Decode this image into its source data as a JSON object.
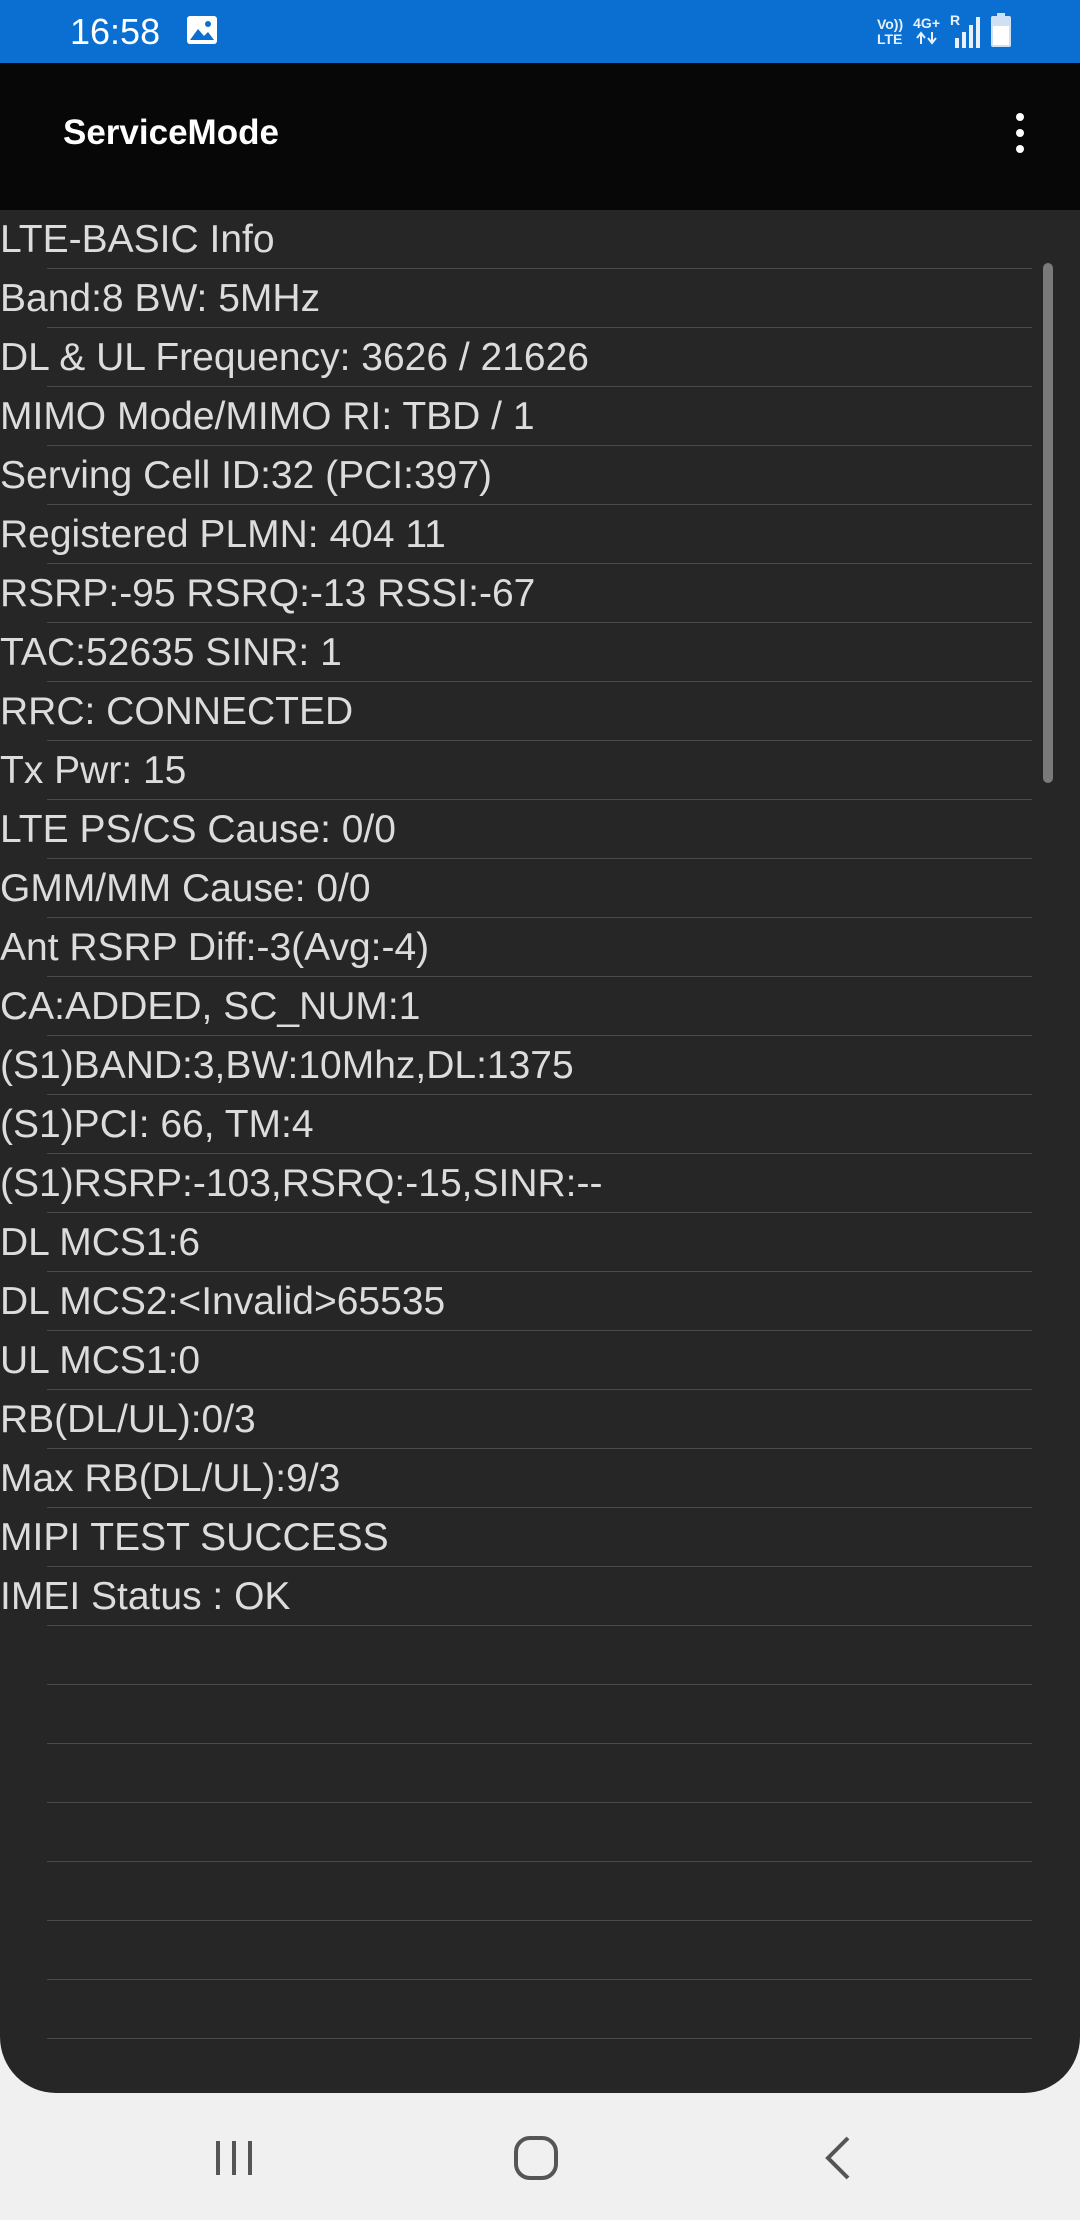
{
  "status_bar": {
    "time": "16:58",
    "volte_top": "Vo))",
    "volte_bottom": "LTE",
    "network": "4G+",
    "roaming": "R",
    "icons": [
      "gallery-icon",
      "volte-icon",
      "data-arrows-icon",
      "signal-icon",
      "battery-icon"
    ]
  },
  "app_bar": {
    "title": "ServiceMode",
    "menu_icon": "more-vert-icon"
  },
  "info_lines": [
    "LTE-BASIC Info",
    "Band:8 BW: 5MHz",
    "DL & UL Frequency: 3626 / 21626",
    "MIMO Mode/MIMO RI: TBD / 1",
    "Serving Cell ID:32 (PCI:397)",
    "Registered PLMN: 404 11",
    "RSRP:-95 RSRQ:-13 RSSI:-67",
    "TAC:52635 SINR: 1",
    "RRC: CONNECTED",
    "Tx Pwr: 15",
    "LTE PS/CS Cause: 0/0",
    "GMM/MM Cause: 0/0",
    "Ant RSRP Diff:-3(Avg:-4)",
    "CA:ADDED, SC_NUM:1",
    "(S1)BAND:3,BW:10Mhz,DL:1375",
    "(S1)PCI: 66, TM:4",
    "(S1)RSRP:-103,RSRQ:-15,SINR:--",
    "DL MCS1:6",
    "DL MCS2:<Invalid>65535",
    "UL MCS1:0",
    "RB(DL/UL):0/3",
    "Max RB(DL/UL):9/3",
    "MIPI TEST SUCCESS",
    "IMEI Status : OK",
    "",
    "",
    "",
    "",
    "",
    "",
    "",
    ""
  ],
  "nav_bar": {
    "icons": [
      "recent-apps-icon",
      "home-icon",
      "back-icon"
    ]
  },
  "colors": {
    "status_bar": "#0a6fd1",
    "app_bar": "#070707",
    "content_bg": "#262626",
    "text": "#dcdcdc",
    "divider": "#4a4a4a"
  }
}
